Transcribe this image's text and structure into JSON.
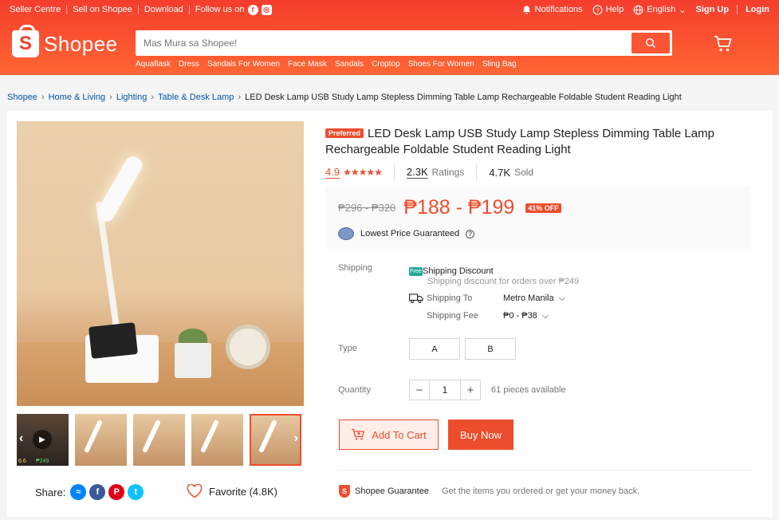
{
  "topbar": {
    "seller_centre": "Seller Centre",
    "sell_on_shopee": "Sell on Shopee",
    "download": "Download",
    "follow_us": "Follow us on",
    "notifications": "Notifications",
    "help": "Help",
    "language": "English",
    "sign_up": "Sign Up",
    "login": "Login"
  },
  "brand": {
    "name": "Shopee",
    "accent": "#ee4d2d"
  },
  "search": {
    "placeholder": "Mas Mura sa Shopee!",
    "hints": [
      "Aquaflask",
      "Dress",
      "Sandals For Women",
      "Face Mask",
      "Sandals",
      "Croptop",
      "Shoes For Women",
      "Sling Bag"
    ]
  },
  "breadcrumb": [
    "Shopee",
    "Home & Living",
    "Lighting",
    "Table & Desk Lamp",
    "LED Desk Lamp USB Study Lamp Stepless Dimming Table Lamp Rechargeable Foldable Student Reading Light"
  ],
  "gallery": {
    "thumb_badge": "6.6",
    "thumb_price": "₱249",
    "share_label": "Share:",
    "favorite_label": "Favorite (4.8K)"
  },
  "product": {
    "badge": "Preferred",
    "title": "LED Desk Lamp USB Study Lamp Stepless Dimming Table Lamp Rechargeable Foldable Student Reading Light",
    "rating": "4.9",
    "stars": 5,
    "ratings_count": "2.3K",
    "ratings_label": "Ratings",
    "sold_count": "4.7K",
    "sold_label": "Sold",
    "original_price": "₱296 - ₱320",
    "price": "₱188 - ₱199",
    "discount": "41% OFF",
    "lowest_price": "Lowest Price Guaranteed"
  },
  "shipping": {
    "label": "Shipping",
    "free_badge": "Free",
    "discount_title": "Shipping Discount",
    "discount_sub": "Shipping discount for orders over ₱249",
    "to_label": "Shipping To",
    "to_value": "Metro Manila",
    "fee_label": "Shipping Fee",
    "fee_value": "₱0 - ₱38"
  },
  "type": {
    "label": "Type",
    "options": [
      "A",
      "B"
    ]
  },
  "quantity": {
    "label": "Quantity",
    "value": "1",
    "available": "61 pieces available"
  },
  "actions": {
    "add_to_cart": "Add To Cart",
    "buy_now": "Buy Now"
  },
  "guarantee": {
    "title": "Shopee Guarantee",
    "desc": "Get the items you ordered or get your money back."
  }
}
